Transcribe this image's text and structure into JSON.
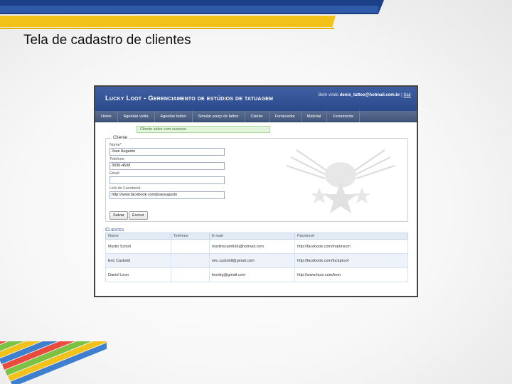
{
  "slide": {
    "title": "Tela de cadastro de clientes"
  },
  "app": {
    "title": "Lucky Loot - Gerenciamento de estúdios de tatuagem",
    "welcome_prefix": "Bem vindo",
    "user_email": "denis_tattoo@hotmail.com.br",
    "logout": "Sair"
  },
  "nav": [
    "Home",
    "Agendar visita",
    "Agendar tattoo",
    "Simular preço de tattoo",
    "Cliente",
    "Fornecedor",
    "Material",
    "Ferramenta"
  ],
  "message": "Cliente salvo com sucesso",
  "form": {
    "legend": "Cliente",
    "nome_label": "Nome*",
    "nome_value": "Jose Augusto",
    "telefone_label": "Telefone",
    "telefone_value": "3930-4538",
    "email_label": "Email",
    "email_value": "",
    "facebook_label": "Link do Facebook",
    "facebook_value": "http://www.facebook.com/joseaugusto",
    "save_label": "Salvar",
    "delete_label": "Excluir"
  },
  "clientes": {
    "title": "Clientes",
    "columns": [
      "Nome",
      "Telefone",
      "E-mail",
      "Facebook"
    ],
    "rows": [
      [
        "Martin Scholl",
        "",
        "martinscam666@hotmail.com",
        "http://facebook.com/martinscm"
      ],
      [
        "Eric Castoldi",
        "",
        "eric.castoldi@gmail.com",
        "http://facebook.com/fuckproof"
      ],
      [
        "Daniel Leon",
        "",
        "leonbg@gmail.com",
        "http://www.face.com/leon"
      ]
    ]
  },
  "colors": {
    "header_blue": "#2b4a8c",
    "slide_yellow": "#f3c21a",
    "success_green": "#e3f6dc"
  }
}
